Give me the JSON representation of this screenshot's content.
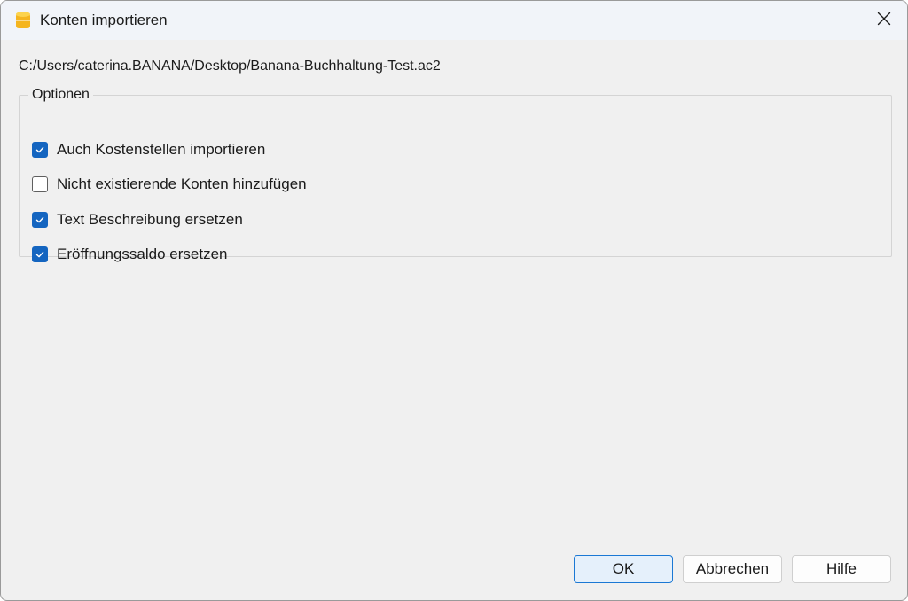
{
  "window": {
    "title": "Konten importieren",
    "app_icon": "banana-coins-icon",
    "close_icon": "close-icon"
  },
  "file_path": "C:/Users/caterina.BANANA/Desktop/Banana-Buchhaltung-Test.ac2",
  "options": {
    "legend": "Optionen",
    "items": [
      {
        "label": "Auch Kostenstellen importieren",
        "checked": true
      },
      {
        "label": "Nicht existierende Konten hinzufügen",
        "checked": false
      },
      {
        "label": "Text Beschreibung ersetzen",
        "checked": true
      },
      {
        "label": "Eröffnungssaldo ersetzen",
        "checked": true
      }
    ]
  },
  "buttons": {
    "ok": "OK",
    "cancel": "Abbrechen",
    "help": "Hilfe"
  },
  "colors": {
    "accent": "#1465c0",
    "app_icon": "#f5b51f"
  }
}
